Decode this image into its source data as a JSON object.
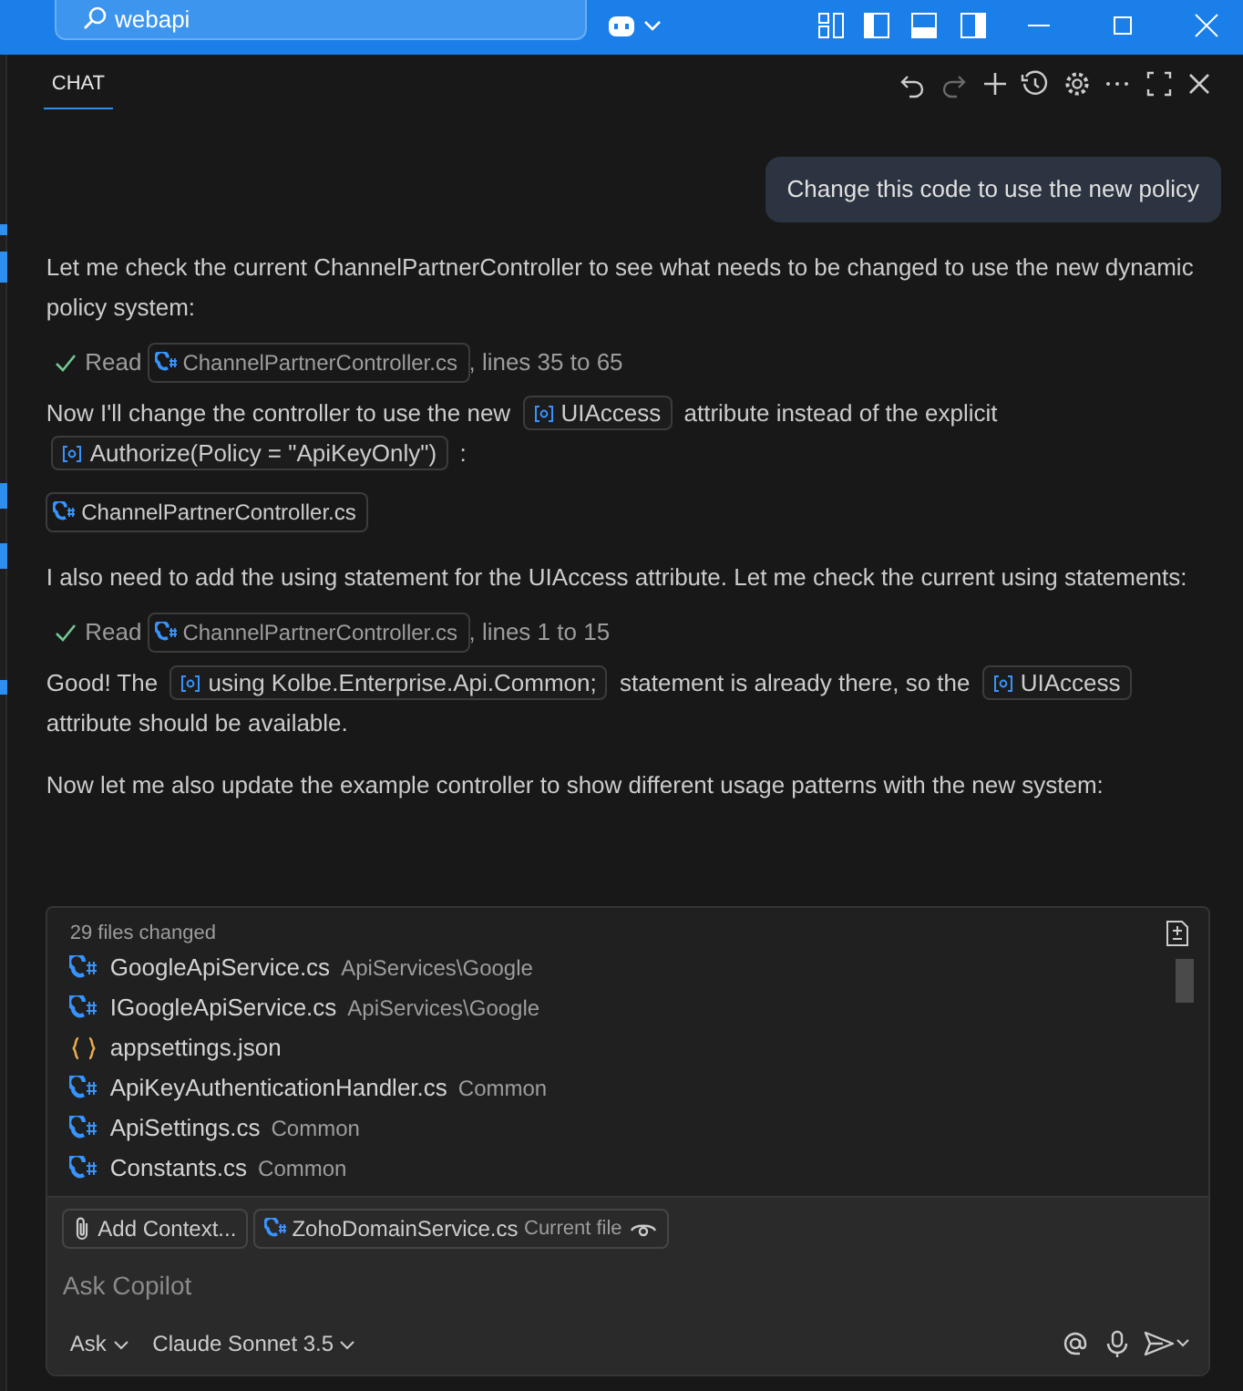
{
  "titlebar": {
    "search": "webapi"
  },
  "panel": {
    "tab": "CHAT",
    "tab_selected": true
  },
  "messages": [
    {
      "kind": "user",
      "text": "Change this code to use the new policy"
    },
    {
      "kind": "paragraph",
      "parts": [
        {
          "kind": "text",
          "text": "Let me check the current ChannelPartnerController to see what needs to be changed to use the new dynamic policy system:"
        }
      ]
    },
    {
      "kind": "tool",
      "done": true,
      "label": "Read",
      "file": "ChannelPartnerController.cs",
      "detail": ", lines 35 to 65"
    },
    {
      "kind": "paragraph",
      "parts": [
        {
          "kind": "text",
          "text": "Now I'll change the controller to use the new"
        },
        {
          "kind": "symbol",
          "text": "UIAccess"
        },
        {
          "kind": "text",
          "text": "attribute instead of the explicit"
        },
        {
          "kind": "symbol",
          "text": "Authorize(Policy = \"ApiKeyOnly\")"
        },
        {
          "kind": "text",
          "text": ":"
        }
      ]
    },
    {
      "kind": "file",
      "text": "ChannelPartnerController.cs"
    },
    {
      "kind": "paragraph",
      "parts": [
        {
          "kind": "text",
          "text": "I also need to add the using statement for the UIAccess attribute. Let me check the current using statements:"
        }
      ]
    },
    {
      "kind": "tool",
      "done": true,
      "label": "Read",
      "file": "ChannelPartnerController.cs",
      "detail": ", lines 1 to 15"
    },
    {
      "kind": "paragraph",
      "parts": [
        {
          "kind": "text",
          "text": "Good! The"
        },
        {
          "kind": "symbol",
          "text": "using Kolbe.Enterprise.Api.Common;"
        },
        {
          "kind": "text",
          "text": "statement is already there, so the"
        },
        {
          "kind": "symbol",
          "text": "UIAccess"
        },
        {
          "kind": "text",
          "text": "attribute should be available."
        }
      ]
    },
    {
      "kind": "paragraph",
      "parts": [
        {
          "kind": "text",
          "text": "Now let me also update the example controller to show different usage patterns with the new system:"
        }
      ]
    }
  ],
  "changes": {
    "title": "29 files changed",
    "files": [
      {
        "kind": "cs",
        "name": "GoogleApiService.cs",
        "folder": "ApiServices\\Google"
      },
      {
        "kind": "cs",
        "name": "IGoogleApiService.cs",
        "folder": "ApiServices\\Google"
      },
      {
        "kind": "json",
        "name": "appsettings.json"
      },
      {
        "kind": "cs",
        "name": "ApiKeyAuthenticationHandler.cs",
        "folder": "Common"
      },
      {
        "kind": "cs",
        "name": "ApiSettings.cs",
        "folder": "Common"
      },
      {
        "kind": "cs",
        "name": "Constants.cs",
        "folder": "Common"
      }
    ]
  },
  "input": {
    "add_context": "Add Context...",
    "current_file": {
      "name": "ZohoDomainService.cs",
      "note": "Current file"
    },
    "placeholder": "Ask Copilot",
    "mode": "Ask",
    "model": "Claude Sonnet 3.5"
  }
}
